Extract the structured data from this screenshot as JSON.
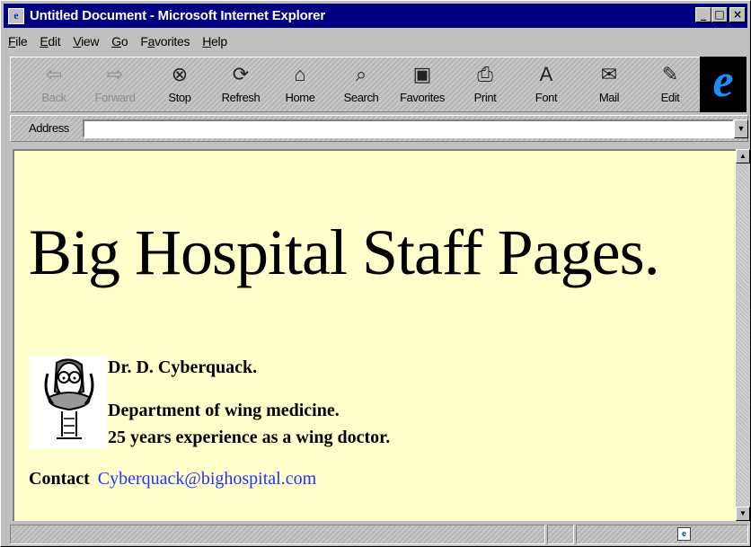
{
  "window": {
    "title": "Untitled Document - Microsoft Internet Explorer",
    "controls": {
      "minimize": "_",
      "maximize": "□",
      "close": "×"
    }
  },
  "menu": [
    "File",
    "Edit",
    "View",
    "Go",
    "Favorites",
    "Help"
  ],
  "menu_accel": [
    "F",
    "E",
    "V",
    "G",
    "a",
    "H"
  ],
  "toolbar": {
    "buttons": [
      {
        "label": "Back",
        "icon": "back-arrow-icon",
        "glyph": "⇦",
        "enabled": false
      },
      {
        "label": "Forward",
        "icon": "forward-arrow-icon",
        "glyph": "⇨",
        "enabled": false
      },
      {
        "label": "Stop",
        "icon": "stop-icon",
        "glyph": "⊗",
        "enabled": true
      },
      {
        "label": "Refresh",
        "icon": "refresh-icon",
        "glyph": "⟳",
        "enabled": true
      },
      {
        "label": "Home",
        "icon": "home-icon",
        "glyph": "⌂",
        "enabled": true
      },
      {
        "label": "Search",
        "icon": "search-icon",
        "glyph": "⌕",
        "enabled": true
      },
      {
        "label": "Favorites",
        "icon": "favorites-folder-icon",
        "glyph": "▣",
        "enabled": true
      },
      {
        "label": "Print",
        "icon": "printer-icon",
        "glyph": "⎙",
        "enabled": true
      },
      {
        "label": "Font",
        "icon": "font-icon",
        "glyph": "A",
        "enabled": true
      },
      {
        "label": "Mail",
        "icon": "mail-icon",
        "glyph": "✉",
        "enabled": true
      },
      {
        "label": "Edit",
        "icon": "edit-icon",
        "glyph": "✎",
        "enabled": true
      }
    ]
  },
  "address": {
    "label": "Address",
    "value": ""
  },
  "page": {
    "heading": "Big Hospital Staff Pages.",
    "doctor_name": "Dr. D. Cyberquack.",
    "department": "Department of wing medicine.",
    "experience": "25 years experience as a wing doctor.",
    "contact_label": "Contact",
    "contact_email": "Cyberquack@bighospital.com"
  },
  "colors": {
    "titlebar": "#000080",
    "page_background": "#ffffcc",
    "link": "#2233ff"
  }
}
